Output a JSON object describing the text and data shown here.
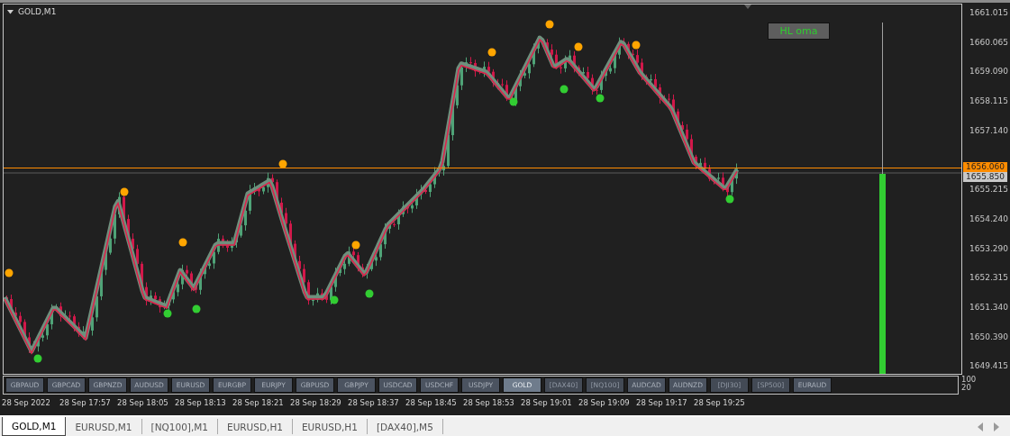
{
  "chart": {
    "title": "GOLD,M1",
    "indicator_label": "HL oma",
    "price_ticks": [
      "1661.015",
      "1660.065",
      "1659.090",
      "1658.115",
      "1657.140",
      "1655.215",
      "1654.240",
      "1653.290",
      "1652.315",
      "1651.340",
      "1650.390",
      "1649.415"
    ],
    "price_tags": [
      {
        "text": "1656.060",
        "kind": "bid"
      },
      {
        "text": "1655.850",
        "kind": "last"
      }
    ]
  },
  "symbol_buttons": [
    {
      "label": "GBPAUD",
      "selected": false,
      "disabled": false
    },
    {
      "label": "GBPCAD",
      "selected": false,
      "disabled": false
    },
    {
      "label": "GBPNZD",
      "selected": false,
      "disabled": false
    },
    {
      "label": "AUDUSD",
      "selected": false,
      "disabled": false
    },
    {
      "label": "EURUSD",
      "selected": false,
      "disabled": false
    },
    {
      "label": "EURGBP",
      "selected": false,
      "disabled": false
    },
    {
      "label": "EURJPY",
      "selected": false,
      "disabled": false
    },
    {
      "label": "GBPUSD",
      "selected": false,
      "disabled": false
    },
    {
      "label": "GBPJPY",
      "selected": false,
      "disabled": false
    },
    {
      "label": "USDCAD",
      "selected": false,
      "disabled": false
    },
    {
      "label": "USDCHF",
      "selected": false,
      "disabled": false
    },
    {
      "label": "USDJPY",
      "selected": false,
      "disabled": false
    },
    {
      "label": "GOLD",
      "selected": true,
      "disabled": false
    },
    {
      "label": "[DAX40]",
      "selected": false,
      "disabled": true
    },
    {
      "label": "[NQ100]",
      "selected": false,
      "disabled": true
    },
    {
      "label": "AUDCAD",
      "selected": false,
      "disabled": false
    },
    {
      "label": "AUDNZD",
      "selected": false,
      "disabled": false
    },
    {
      "label": "[DJI30]",
      "selected": false,
      "disabled": true
    },
    {
      "label": "[SP500]",
      "selected": false,
      "disabled": true
    },
    {
      "label": "EURAUD",
      "selected": false,
      "disabled": false
    }
  ],
  "indicator_scale": [
    "100",
    "20"
  ],
  "time_ticks": [
    "28 Sep 2022",
    "28 Sep 17:57",
    "28 Sep 18:05",
    "28 Sep 18:13",
    "28 Sep 18:21",
    "28 Sep 18:29",
    "28 Sep 18:37",
    "28 Sep 18:45",
    "28 Sep 18:53",
    "28 Sep 19:01",
    "28 Sep 19:09",
    "28 Sep 19:17",
    "28 Sep 19:25"
  ],
  "tabs": [
    {
      "label": "GOLD,M1",
      "selected": true
    },
    {
      "label": "EURUSD,M1",
      "selected": false
    },
    {
      "label": "[NQ100],M1",
      "selected": false
    },
    {
      "label": "EURUSD,H1",
      "selected": false
    },
    {
      "label": "EURUSD,H1",
      "selected": false
    },
    {
      "label": "[DAX40],M5",
      "selected": false
    }
  ]
}
